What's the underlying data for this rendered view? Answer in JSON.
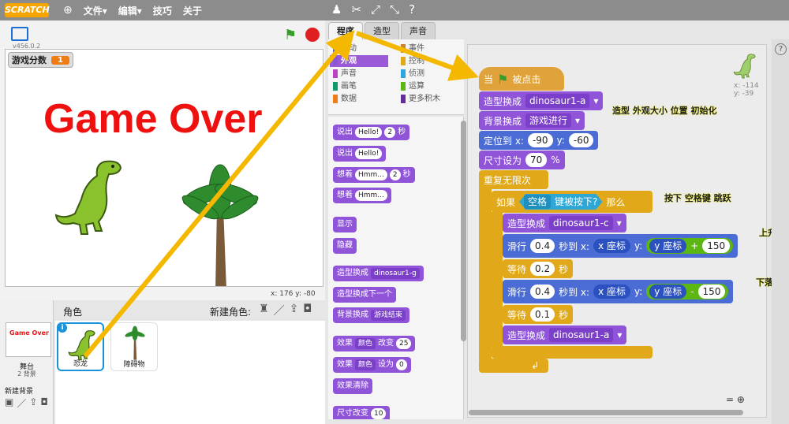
{
  "menubar": {
    "logo": "SCRATCH",
    "file": "文件▾",
    "edit": "编辑▾",
    "tips": "技巧",
    "about": "关于"
  },
  "stage": {
    "version": "v456.0.2",
    "var_name": "游戏分数",
    "var_value": "1",
    "game_over": "Game Over",
    "coords_x_label": "x:",
    "coords_x": "176",
    "coords_y_label": "y:",
    "coords_y": "-80"
  },
  "sprites": {
    "title": "角色",
    "new_sprite": "新建角色:",
    "stage_thumb_text": "Game Over",
    "stage_label": "舞台",
    "stage_bg_count": "2 背景",
    "new_bg": "新建背景",
    "items": [
      {
        "name": "恐龙"
      },
      {
        "name": "障碍物"
      }
    ]
  },
  "tabs": [
    {
      "label": "程序"
    },
    {
      "label": "造型"
    },
    {
      "label": "声音"
    }
  ],
  "categories": [
    {
      "label": "运动",
      "color": "#4a6cd4"
    },
    {
      "label": "外观",
      "color": "#8a55d7"
    },
    {
      "label": "声音",
      "color": "#bb42c3"
    },
    {
      "label": "画笔",
      "color": "#0e9a6c"
    },
    {
      "label": "数据",
      "color": "#ee7d16"
    },
    {
      "label": "事件",
      "color": "#c88330"
    },
    {
      "label": "控制",
      "color": "#e1a91a"
    },
    {
      "label": "侦测",
      "color": "#2ca5e2"
    },
    {
      "label": "运算",
      "color": "#5cb712"
    },
    {
      "label": "更多积木",
      "color": "#632d99"
    }
  ],
  "palette": {
    "say_secs": {
      "label": "说出",
      "text": "Hello!",
      "secs": "2",
      "unit": "秒"
    },
    "say": {
      "label": "说出",
      "text": "Hello!"
    },
    "think_secs": {
      "label": "想着",
      "text": "Hmm...",
      "secs": "2",
      "unit": "秒"
    },
    "think": {
      "label": "想着",
      "text": "Hmm..."
    },
    "show": "显示",
    "hide": "隐藏",
    "switch_costume": {
      "label": "造型换成",
      "value": "dinosaur1-g"
    },
    "next_costume": "造型换成下一个",
    "switch_bg": {
      "label": "背景换成",
      "value": "游戏结束"
    },
    "change_effect": {
      "label": "效果",
      "effect": "颜色",
      "verb": "改变",
      "value": "25"
    },
    "set_effect": {
      "label": "效果",
      "effect": "颜色",
      "verb": "设为",
      "value": "0"
    },
    "clear_effects": "效果清除",
    "change_size": {
      "label": "尺寸改变",
      "value": "10"
    }
  },
  "script": {
    "hat": {
      "when": "当",
      "clicked": "被点击"
    },
    "switch_costume_a": {
      "label": "造型换成",
      "value": "dinosaur1-a"
    },
    "switch_bg": {
      "label": "背景换成",
      "value": "游戏进行"
    },
    "goto": {
      "label": "定位到 x:",
      "x": "-90",
      "y_label": "y:",
      "y": "-60"
    },
    "set_size": {
      "label": "尺寸设为",
      "value": "70",
      "unit": "%"
    },
    "forever": "重复无限次",
    "if": {
      "label": "如果",
      "key": "空格",
      "pressed": "键被按下?",
      "then": "那么"
    },
    "switch_costume_c": {
      "label": "造型换成",
      "value": "dinosaur1-c"
    },
    "glide_up": {
      "label": "滑行",
      "secs": "0.4",
      "to": "秒到 x:",
      "xval": "x 座标",
      "y_label": "y:",
      "yval": "y 座标",
      "op": "+",
      "num": "150"
    },
    "wait1": {
      "label": "等待",
      "value": "0.2",
      "unit": "秒"
    },
    "glide_down": {
      "label": "滑行",
      "secs": "0.4",
      "to": "秒到 x:",
      "xval": "x 座标",
      "y_label": "y:",
      "yval": "y 座标",
      "op": "-",
      "num": "150"
    },
    "wait2": {
      "label": "等待",
      "value": "0.1",
      "unit": "秒"
    },
    "switch_costume_a2": {
      "label": "造型换成",
      "value": "dinosaur1-a"
    },
    "sprite_x": "x: -114",
    "sprite_y": "y: -39"
  },
  "annotations": {
    "init": "造型 外观大小 位置 初始化",
    "press": "按下 空格键 跳跃",
    "up": "上升",
    "down": "下落"
  },
  "colors": {
    "arrow": "#f5b800"
  }
}
